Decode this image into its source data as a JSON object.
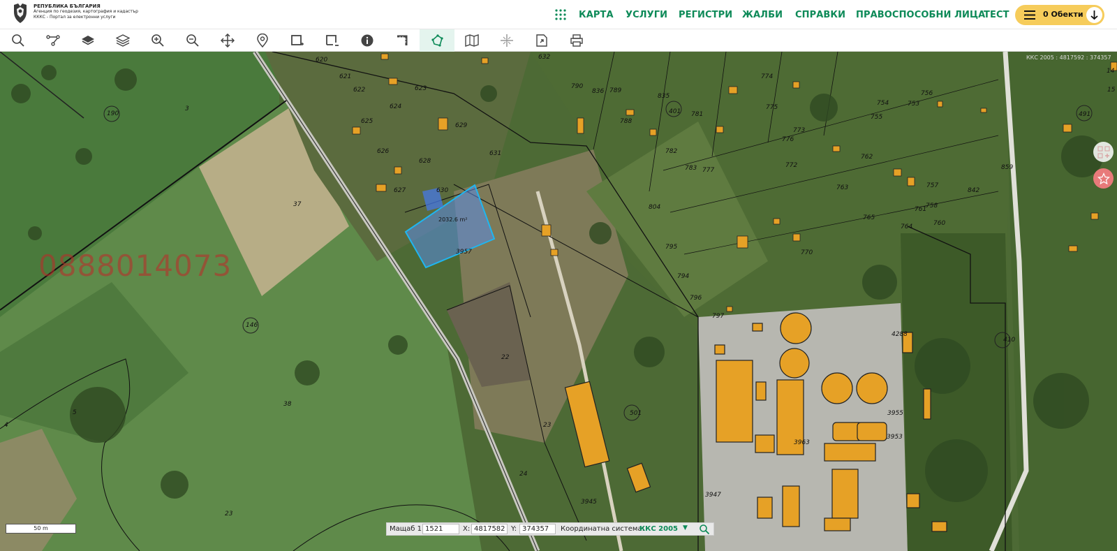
{
  "brand": {
    "line1": "РЕПУБЛИКА БЪЛГАРИЯ",
    "line2": "Агенция по геодезия, картография и кадастър",
    "line3": "КККС - Портал за електронни услуги"
  },
  "nav": {
    "items": [
      "КАРТА",
      "УСЛУГИ",
      "РЕГИСТРИ",
      "ЖАЛБИ",
      "СПРАВКИ",
      "ПРАВОСПОСОБНИ ЛИЦА",
      "ТЕСТ"
    ],
    "objects_label": "0 Обекти"
  },
  "toolbar": {
    "tools": [
      "search-icon",
      "route-icon",
      "layers-icon",
      "layers-stack-icon",
      "zoom-in-icon",
      "zoom-out-icon",
      "pan-icon",
      "marker-icon",
      "select-rect-add-icon",
      "select-rect-remove-icon",
      "info-icon",
      "measure-distance-icon",
      "measure-area-icon",
      "map-book-icon",
      "crosshair-icon",
      "export-icon",
      "print-icon"
    ],
    "active_tool": "measure-area-icon"
  },
  "map": {
    "watermark": "0888014073",
    "measured_area": "2032.6 m²",
    "parcels": [
      "620",
      "621",
      "622",
      "623",
      "624",
      "625",
      "626",
      "627",
      "628",
      "629",
      "630",
      "631",
      "632",
      "790",
      "789",
      "835",
      "836",
      "401",
      "781",
      "782",
      "783",
      "788",
      "774",
      "773",
      "775",
      "776",
      "777",
      "772",
      "763",
      "762",
      "755",
      "754",
      "753",
      "756",
      "761",
      "760",
      "758",
      "757",
      "764",
      "765",
      "770",
      "804",
      "795",
      "794",
      "797",
      "796",
      "842",
      "859",
      "491",
      "14",
      "15",
      "190",
      "3",
      "37",
      "146",
      "5",
      "4",
      "38",
      "23",
      "22",
      "24",
      "23",
      "3947",
      "3957",
      "3963",
      "3953",
      "3955",
      "501",
      "410",
      "4288",
      "3945"
    ],
    "scale_text": "50 m",
    "coord_bar": {
      "scale_label": "Мащаб 1:",
      "scale_value": "1521",
      "x_label": "X:",
      "x_value": "4817582",
      "y_label": "Y:",
      "y_value": "374357",
      "system_label": "Координатна система:",
      "system_value": "ККС 2005"
    },
    "corner_label": "ККС 2005 : 4817592 : 374357"
  },
  "colors": {
    "accent": "#0d8a58",
    "objects_button": "#f6cc5b",
    "building": "#e6a126",
    "selection": "#1fb6f0"
  }
}
